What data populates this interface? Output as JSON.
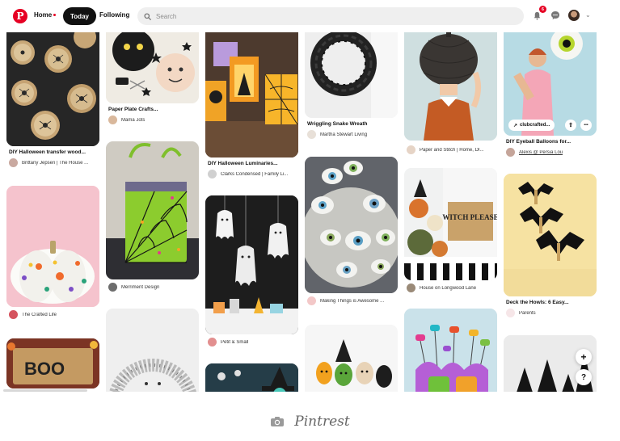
{
  "topbar": {
    "logo_letter": "P",
    "home": "Home",
    "today": "Today",
    "following": "Following",
    "search_placeholder": "Search",
    "notification_count": "6"
  },
  "pins": [
    {
      "id": "c1a",
      "title": "DIY Halloween transfer wood...",
      "source": "Brittany Jepsen | The House ..."
    },
    {
      "id": "c1b",
      "title": "",
      "source": "The Crafted Life"
    },
    {
      "id": "c1c",
      "title": "",
      "source": ""
    },
    {
      "id": "c2a",
      "title": "Paper Plate Crafts...",
      "source": "Mama Jots"
    },
    {
      "id": "c2b",
      "title": "",
      "source": "Merriment Design"
    },
    {
      "id": "c2c",
      "title": "",
      "source": ""
    },
    {
      "id": "c3a",
      "title": "DIY Halloween Luminaries...",
      "source": "Clarks Condensed | Family Li..."
    },
    {
      "id": "c3b",
      "title": "",
      "source": "Petit & Small"
    },
    {
      "id": "c3c",
      "title": "",
      "source": ""
    },
    {
      "id": "c4a",
      "title": "Wriggling Snake Wreath",
      "source": "Martha Stewart Living"
    },
    {
      "id": "c4b",
      "title": "",
      "source": "Making Things is Awesome ..."
    },
    {
      "id": "c4c",
      "title": "",
      "source": ""
    },
    {
      "id": "c5a",
      "title": "",
      "source": "Paper and Stitch | Home, DI..."
    },
    {
      "id": "c5b",
      "title": "",
      "source": "House on Longwood Lane"
    },
    {
      "id": "c5c",
      "title": "",
      "source": ""
    },
    {
      "id": "c6a",
      "title": "DIY Eyeball Balloons for...",
      "source": "Alexis @ Persia Lou",
      "chip": "clubcrafted...",
      "share": "⇧",
      "more": "•••"
    },
    {
      "id": "c6b",
      "title": "Deck the Howls: 6 Easy...",
      "source": "Parents"
    },
    {
      "id": "c6c",
      "title": "",
      "source": ""
    }
  ],
  "image_text": {
    "boo": "BOO",
    "witch_please": "WITCH PLEASE"
  },
  "floating": {
    "add": "+",
    "help": "?"
  },
  "caption": "Pintrest",
  "colors": {
    "brand": "#e60023",
    "today_bg": "#111111",
    "search_bg": "#efefef"
  },
  "icons": [
    "pinterest-logo-icon",
    "search-icon",
    "bell-icon",
    "chat-icon",
    "camera-icon"
  ]
}
